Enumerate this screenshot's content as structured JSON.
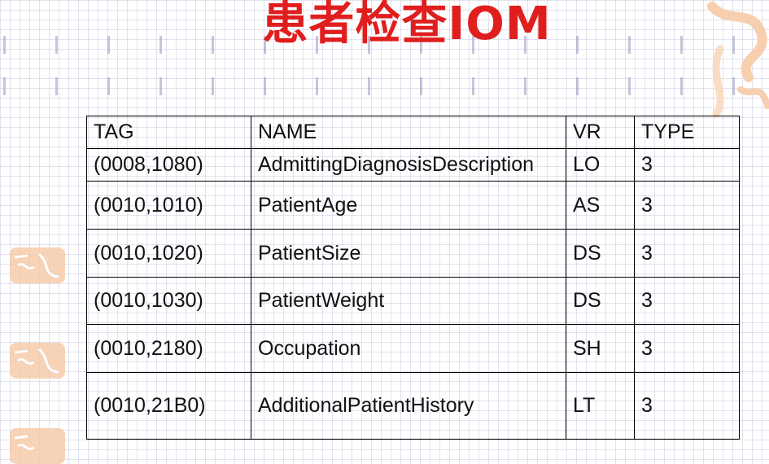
{
  "title": {
    "cjk": "患者检查",
    "latin": "IOM"
  },
  "table": {
    "headers": [
      "TAG",
      "NAME",
      "VR",
      "TYPE"
    ],
    "rows": [
      [
        "(0008,1080)",
        "AdmittingDiagnosisDescription",
        "LO",
        "3"
      ],
      [
        "(0010,1010)",
        "PatientAge",
        "AS",
        "3"
      ],
      [
        "(0010,1020)",
        "PatientSize",
        "DS",
        "3"
      ],
      [
        "(0010,1030)",
        "PatientWeight",
        "DS",
        "3"
      ],
      [
        "(0010,2180)",
        "Occupation",
        "SH",
        "3"
      ],
      [
        "(0010,21B0)",
        "AdditionalPatientHistory",
        "LT",
        "3"
      ]
    ]
  },
  "colors": {
    "title": "#e01e1e",
    "seal": "#f6c9a6",
    "grid": "#afafd2"
  },
  "decorations": [
    "calligraphy-seal",
    "corner-calligraphy"
  ]
}
